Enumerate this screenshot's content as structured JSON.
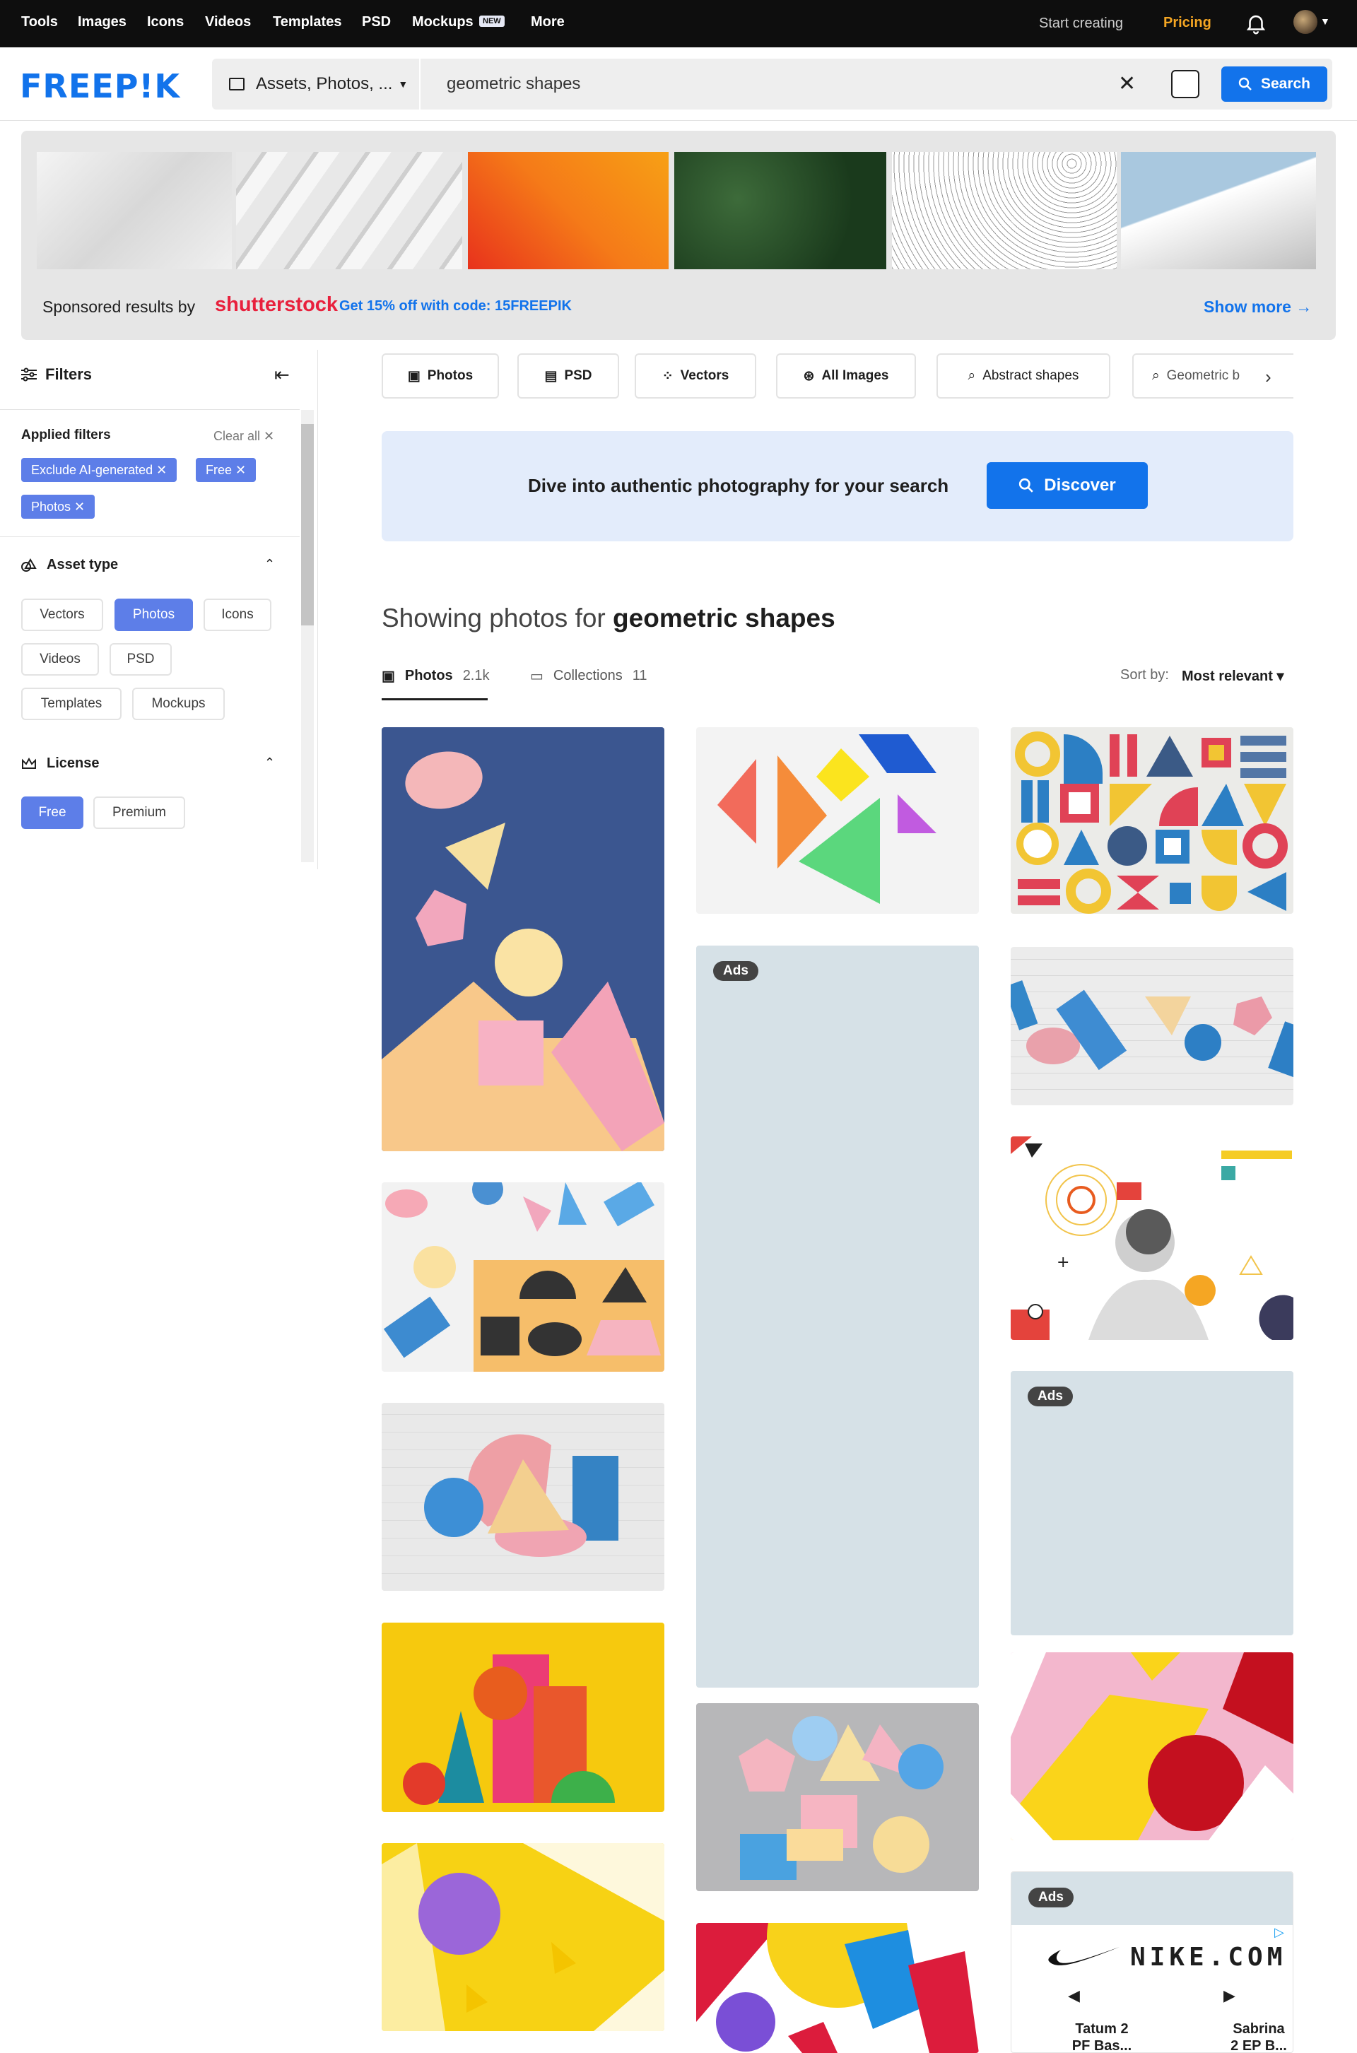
{
  "topnav": {
    "items": [
      "Tools",
      "Images",
      "Icons",
      "Videos",
      "Templates",
      "PSD",
      "Mockups",
      "More"
    ],
    "new_badge": "NEW",
    "start_creating": "Start creating",
    "pricing": "Pricing"
  },
  "header": {
    "logo": "FREEP!K",
    "asset_selector": "Assets, Photos, ...",
    "search_value": "geometric shapes",
    "search_button": "Search"
  },
  "sponsored": {
    "label": "Sponsored results by",
    "brand": "shutterstock",
    "promo": "Get 15% off with code: 15FREEPIK",
    "show_more": "Show more"
  },
  "filters": {
    "title": "Filters",
    "applied_title": "Applied filters",
    "clear_all": "Clear all",
    "applied_chips": [
      "Exclude AI-generated",
      "Free",
      "Photos"
    ],
    "asset_type": {
      "title": "Asset type",
      "options": [
        "Vectors",
        "Photos",
        "Icons",
        "Videos",
        "PSD",
        "Templates",
        "Mockups"
      ],
      "selected": "Photos"
    },
    "license": {
      "title": "License",
      "options": [
        "Free",
        "Premium"
      ],
      "selected": "Free"
    }
  },
  "category_tabs": [
    "Photos",
    "PSD",
    "Vectors",
    "All Images",
    "Abstract shapes",
    "Geometric b"
  ],
  "discover_banner": {
    "text": "Dive into authentic photography for your search",
    "button": "Discover"
  },
  "results": {
    "showing_prefix": "Showing photos for",
    "query": "geometric shapes",
    "tabs": [
      {
        "label": "Photos",
        "count": "2.1k"
      },
      {
        "label": "Collections",
        "count": "11"
      }
    ],
    "sort_label": "Sort by:",
    "sort_value": "Most relevant",
    "ad_label": "Ads",
    "nike_domain": "NIKE.COM",
    "nike_products": [
      "Tatum 2 PF Bas...",
      "Sabrina 2 EP B..."
    ]
  },
  "colors": {
    "brand_blue": "#1273eb",
    "chip_blue": "#5d7ee8",
    "pricing_orange": "#f5a623",
    "shutterstock_red": "#e8203c"
  }
}
